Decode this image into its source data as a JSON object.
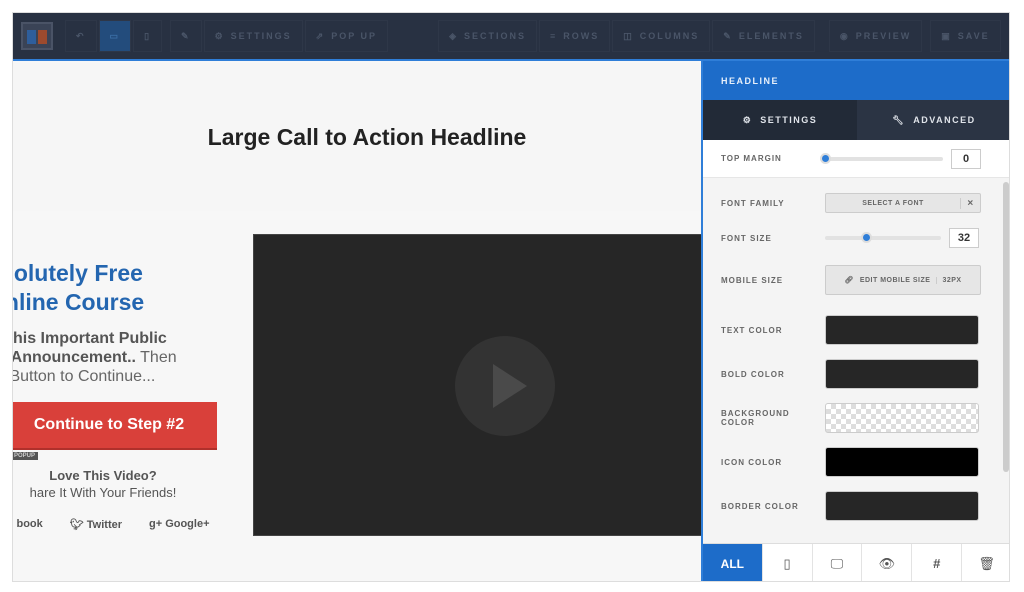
{
  "toolbar": {
    "settings": "SETTINGS",
    "popup": "POP UP",
    "sections": "SECTIONS",
    "rows": "ROWS",
    "columns": "COLUMNS",
    "elements": "ELEMENTS",
    "preview": "PREVIEW",
    "save": "SAVE"
  },
  "canvas": {
    "headline": "Large Call to Action Headline",
    "title_line1": "bsolutely Free",
    "title_line2": "Online Course",
    "sub_line1": "h This Important Public",
    "sub_line2_bold": "ce Announcement..",
    "sub_line2_rest": " Then",
    "sub_line3": "ck Button to Continue...",
    "cta": "Continue to Step #2",
    "popup_tag": "POPUP",
    "love": "Love This Video?",
    "share": "hare It With Your Friends!",
    "social": [
      "book",
      "Twitter",
      "Google+"
    ]
  },
  "panel": {
    "header": "HEADLINE",
    "tabs": {
      "settings": "SETTINGS",
      "advanced": "ADVANCED"
    },
    "top_margin": {
      "label": "TOP MARGIN",
      "value": "0",
      "slider_fraction": 0
    },
    "font_family": {
      "label": "FONT FAMILY",
      "button": "SELECT A FONT",
      "clear": "×"
    },
    "font_size": {
      "label": "FONT SIZE",
      "value": "32",
      "slider_fraction": 0.35
    },
    "mobile_size": {
      "label": "MOBILE SIZE",
      "button": "EDIT MOBILE SIZE",
      "value": "32PX"
    },
    "colors": [
      {
        "label": "TEXT COLOR",
        "color": "#262626"
      },
      {
        "label": "BOLD COLOR",
        "color": "#262626"
      },
      {
        "label": "BACKGROUND COLOR",
        "color": "transparent"
      },
      {
        "label": "ICON COLOR",
        "color": "#000000"
      },
      {
        "label": "BORDER COLOR",
        "color": "#262626"
      }
    ],
    "bottom": {
      "all": "ALL",
      "hash": "#"
    }
  },
  "accent": "#1d6cc9"
}
